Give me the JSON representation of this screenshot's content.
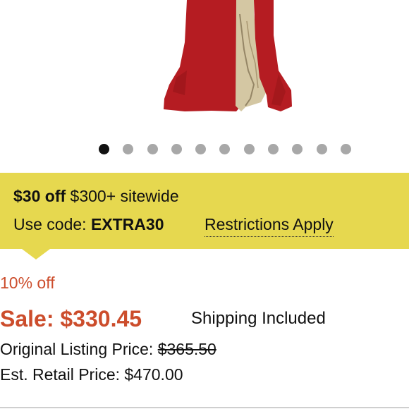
{
  "carousel": {
    "image_description_icon": "dress-photo",
    "dots": [
      {
        "active": true
      },
      {
        "active": false
      },
      {
        "active": false
      },
      {
        "active": false
      },
      {
        "active": false
      },
      {
        "active": false
      },
      {
        "active": false
      },
      {
        "active": false
      },
      {
        "active": false
      },
      {
        "active": false
      },
      {
        "active": false
      }
    ]
  },
  "promo": {
    "offer_bold": "$30 off",
    "offer_rest": "$300+ sitewide",
    "code_label": "Use code:",
    "code_value": "EXTRA30",
    "restrictions": "Restrictions Apply"
  },
  "pricing": {
    "discount": "10% off",
    "sale_label": "Sale:",
    "sale_price": "$330.45",
    "shipping": "Shipping Included",
    "original_label": "Original Listing Price:",
    "original_price": "$365.50",
    "retail_label": "Est. Retail Price:",
    "retail_price": "$470.00"
  },
  "colors": {
    "promo_bg": "#e6d84f",
    "sale_red": "#cc4d2c",
    "dress_red": "#b51c22"
  }
}
